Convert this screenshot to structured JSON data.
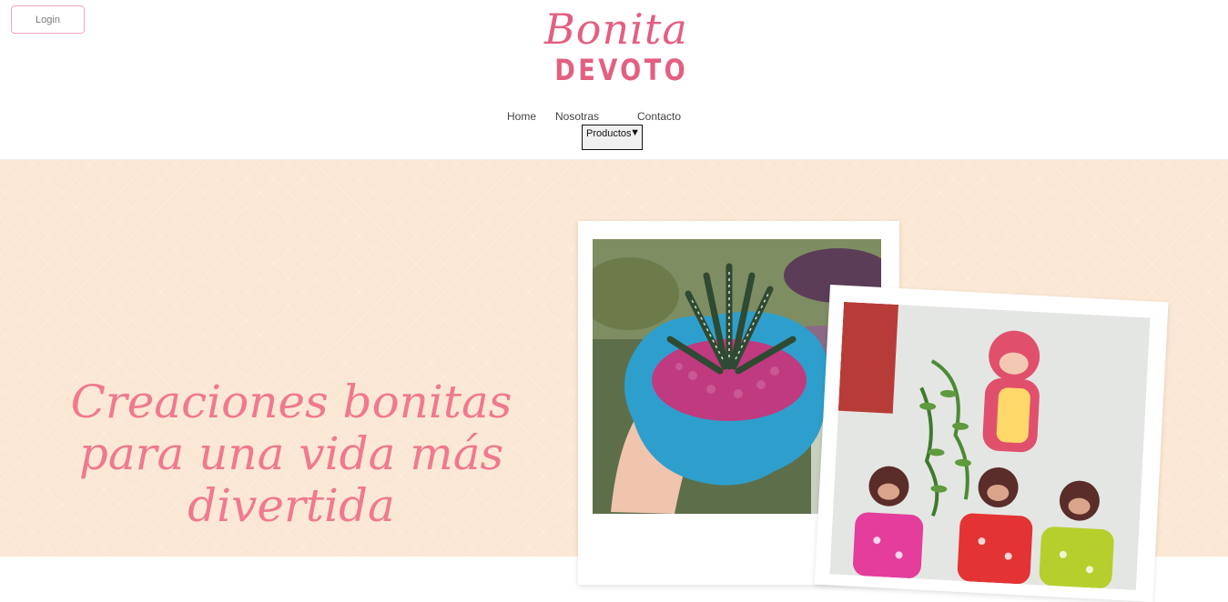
{
  "header": {
    "login_label": "Login",
    "logo": {
      "script": "Bonita",
      "block": "DEVOTO"
    },
    "nav": [
      {
        "label": "Home"
      },
      {
        "label": "Nosotras"
      },
      {
        "label": "Contacto"
      }
    ],
    "products_dropdown": {
      "label": "Productos",
      "caret": "▼"
    }
  },
  "hero": {
    "tagline_lines": [
      "Creaciones bonitas",
      "para una vida más",
      "divertida"
    ],
    "photos": [
      {
        "subject": "succulent-in-blue-pot"
      },
      {
        "subject": "monkey-planters"
      }
    ]
  },
  "colors": {
    "brand_pink": "#e35f80",
    "tagline_pink": "#f0798e",
    "hero_bg": "#fbe8d4"
  }
}
